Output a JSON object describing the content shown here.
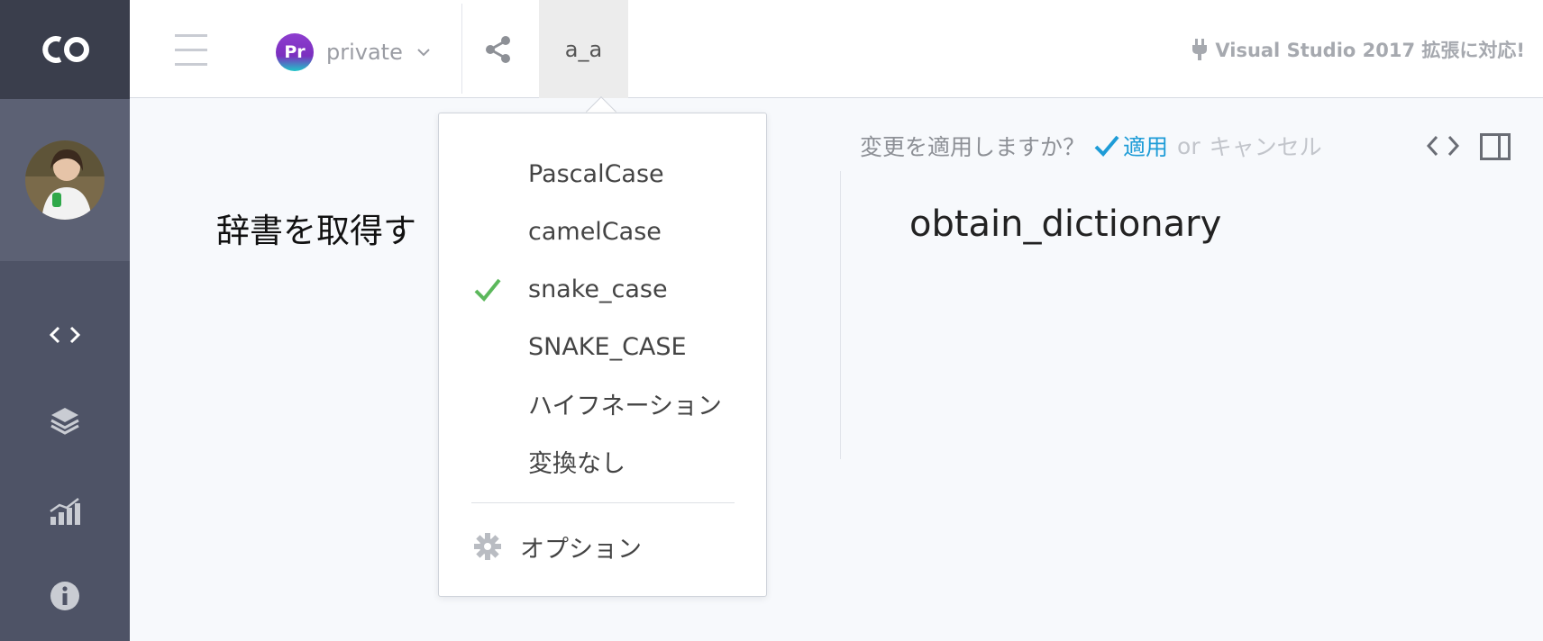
{
  "sidebar": {
    "logo_text": "CO",
    "nav": [
      {
        "icon": "code-icon"
      },
      {
        "icon": "layers-icon"
      },
      {
        "icon": "chart-icon"
      },
      {
        "icon": "info-icon"
      }
    ]
  },
  "topbar": {
    "project_badge": "Pr",
    "project_name": "private",
    "case_tab_label": "a_a",
    "notice": "Visual Studio 2017 拡張に対応!"
  },
  "main": {
    "input_text": "辞書を取得す",
    "output_text": "obtain_dictionary",
    "confirm_question": "変更を適用しますか？",
    "apply_label": "適用",
    "or_label": "or",
    "cancel_label": "キャンセル"
  },
  "dropdown": {
    "items": [
      {
        "label": "PascalCase",
        "checked": false
      },
      {
        "label": "camelCase",
        "checked": false
      },
      {
        "label": "snake_case",
        "checked": true
      },
      {
        "label": "SNAKE_CASE",
        "checked": false
      },
      {
        "label": "ハイフネーション",
        "checked": false
      },
      {
        "label": "変換なし",
        "checked": false
      }
    ],
    "option_label": "オプション"
  },
  "colors": {
    "sidebar": "#4e5366",
    "accent": "#1e9cd7",
    "check": "#5cb85c"
  }
}
